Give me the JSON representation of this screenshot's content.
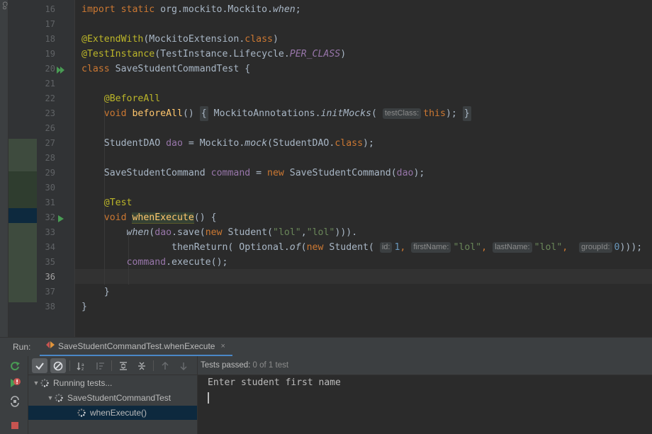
{
  "side_strip": {
    "vertical_label": "Co"
  },
  "editor": {
    "lines": [
      {
        "num": "16",
        "parts": [
          [
            "kw",
            "import static "
          ],
          [
            "",
            "org.mockito.Mockito."
          ],
          [
            "it",
            "when"
          ],
          [
            "",
            ";"
          ]
        ]
      },
      {
        "num": "17",
        "parts": []
      },
      {
        "num": "18",
        "parts": [
          [
            "ann",
            "@ExtendWith"
          ],
          [
            "",
            "(MockitoExtension."
          ],
          [
            "kw",
            "class"
          ],
          [
            "",
            ")"
          ]
        ]
      },
      {
        "num": "19",
        "parts": [
          [
            "ann",
            "@TestInstance"
          ],
          [
            "",
            "(TestInstance.Lifecycle."
          ],
          [
            "fld-it",
            "PER_CLASS"
          ],
          [
            "",
            ")"
          ]
        ]
      },
      {
        "num": "20",
        "parts": [
          [
            "kw",
            "class "
          ],
          [
            "",
            "SaveStudentCommandTest {"
          ]
        ]
      },
      {
        "num": "21",
        "parts": []
      },
      {
        "num": "22",
        "parts": [
          [
            "",
            "    "
          ],
          [
            "ann",
            "@BeforeAll"
          ]
        ]
      },
      {
        "num": "23",
        "parts": [
          [
            "",
            "    "
          ],
          [
            "kw",
            "void "
          ],
          [
            "fn",
            "beforeAll"
          ],
          [
            "",
            "() "
          ],
          [
            "fold",
            "{"
          ],
          [
            "",
            " MockitoAnnotations."
          ],
          [
            "it",
            "initMocks"
          ],
          [
            "",
            "( "
          ],
          [
            "hint",
            "testClass:"
          ],
          [
            "kw",
            "this"
          ],
          [
            "",
            "); "
          ],
          [
            "fold",
            "}"
          ]
        ]
      },
      {
        "num": "26",
        "parts": []
      },
      {
        "num": "27",
        "parts": [
          [
            "",
            "    StudentDAO "
          ],
          [
            "fld",
            "dao"
          ],
          [
            "",
            " = Mockito."
          ],
          [
            "it",
            "mock"
          ],
          [
            "",
            "(StudentDAO."
          ],
          [
            "kw",
            "class"
          ],
          [
            "",
            ");"
          ]
        ]
      },
      {
        "num": "28",
        "parts": []
      },
      {
        "num": "29",
        "parts": [
          [
            "",
            "    SaveStudentCommand "
          ],
          [
            "fld",
            "command"
          ],
          [
            "",
            " = "
          ],
          [
            "kw",
            "new "
          ],
          [
            "",
            "SaveStudentCommand("
          ],
          [
            "fld",
            "dao"
          ],
          [
            "",
            ");"
          ]
        ]
      },
      {
        "num": "30",
        "parts": []
      },
      {
        "num": "31",
        "parts": [
          [
            "",
            "    "
          ],
          [
            "ann",
            "@Test"
          ]
        ]
      },
      {
        "num": "32",
        "parts": [
          [
            "",
            "    "
          ],
          [
            "kw",
            "void "
          ],
          [
            "fn hl",
            "whenExecute"
          ],
          [
            "",
            "() {"
          ]
        ]
      },
      {
        "num": "33",
        "parts": [
          [
            "",
            "        "
          ],
          [
            "it",
            "when"
          ],
          [
            "",
            "("
          ],
          [
            "fld",
            "dao"
          ],
          [
            "",
            ".save("
          ],
          [
            "kw",
            "new "
          ],
          [
            "",
            "Student("
          ],
          [
            "str",
            "\"lol\""
          ],
          [
            "",
            ","
          ],
          [
            "str",
            "\"lol\""
          ],
          [
            "",
            ")))."
          ]
        ]
      },
      {
        "num": "34",
        "parts": [
          [
            "",
            "                thenReturn( Optional."
          ],
          [
            "it",
            "of"
          ],
          [
            "",
            "("
          ],
          [
            "kw",
            "new "
          ],
          [
            "",
            "Student( "
          ],
          [
            "hint",
            "id:"
          ],
          [
            "num",
            "1"
          ],
          [
            "kw",
            ","
          ],
          [
            "",
            " "
          ],
          [
            "hint",
            "firstName:"
          ],
          [
            "str",
            "\"lol\""
          ],
          [
            "kw",
            ","
          ],
          [
            "",
            " "
          ],
          [
            "hint",
            "lastName:"
          ],
          [
            "str",
            "\"lol\""
          ],
          [
            "kw",
            ","
          ],
          [
            "",
            "  "
          ],
          [
            "hint",
            "groupId:"
          ],
          [
            "num",
            "0"
          ],
          [
            "",
            ")));"
          ]
        ]
      },
      {
        "num": "35",
        "parts": [
          [
            "",
            "        "
          ],
          [
            "fld",
            "command"
          ],
          [
            "",
            ".execute();"
          ]
        ]
      },
      {
        "num": "36",
        "parts": []
      },
      {
        "num": "37",
        "parts": [
          [
            "",
            "    }"
          ]
        ]
      },
      {
        "num": "38",
        "parts": [
          [
            "",
            "}"
          ]
        ]
      }
    ]
  },
  "run_window": {
    "label": "Run:",
    "tab_title": "SaveStudentCommandTest.whenExecute",
    "tab_close": "×",
    "status_label": "Tests passed:",
    "status_count": " 0",
    "status_of": " of 1 test",
    "tree": [
      {
        "label": "Running tests...",
        "arrow": "▼",
        "indent": 6
      },
      {
        "label": "SaveStudentCommandTest",
        "arrow": "▼",
        "indent": 26
      },
      {
        "label": "whenExecute()",
        "arrow": "",
        "indent": 58
      }
    ],
    "console_text": "Enter student first name"
  },
  "colors": {
    "editor_bg": "#2b2b2b",
    "keyword": "#cc7832",
    "annotation": "#bbb529",
    "string": "#6a8759",
    "number": "#6897bb",
    "field": "#9876aa",
    "method_decl": "#ffc66d",
    "run_green": "#499c54",
    "tab_accent": "#4a88c7",
    "error_red": "#c75450"
  },
  "icons": {
    "gutter": [
      "run-class-icon",
      "run-method-icon"
    ],
    "left_bar": [
      "rerun-icon",
      "rerun-failed-icon",
      "toggle-auto-test-icon",
      "stop-icon"
    ],
    "toolbar": [
      "show-passed-icon",
      "show-ignored-icon",
      "sort-alpha-icon",
      "sort-duration-icon",
      "expand-all-icon",
      "collapse-all-icon",
      "prev-failed-icon",
      "next-failed-icon"
    ]
  }
}
